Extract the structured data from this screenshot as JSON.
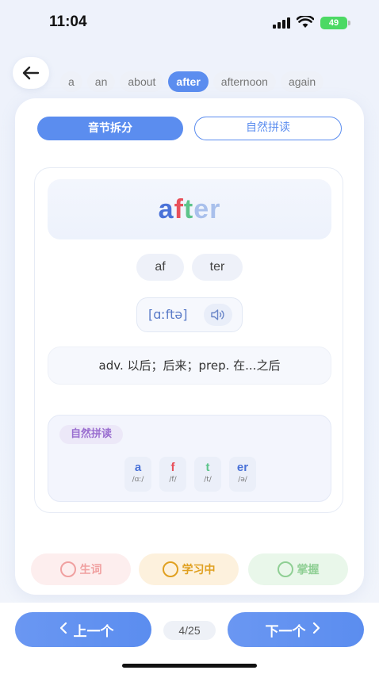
{
  "status_bar": {
    "time": "11:04",
    "battery": "49"
  },
  "word_list": [
    "a",
    "an",
    "about",
    "after",
    "afternoon",
    "again"
  ],
  "word_list_active": "after",
  "mode_tabs": {
    "split": "音节拆分",
    "phonics": "自然拼读"
  },
  "word": {
    "letters": [
      "a",
      "f",
      "t",
      "er"
    ],
    "syllables": [
      "af",
      "ter"
    ],
    "phonetic": "[ɑːftə]",
    "meaning": "adv. 以后；后来；prep. 在...之后"
  },
  "phonics": {
    "label": "自然拼读",
    "units": [
      {
        "letter": "a",
        "ipa": "/ɑː/"
      },
      {
        "letter": "f",
        "ipa": "/f/"
      },
      {
        "letter": "t",
        "ipa": "/t/"
      },
      {
        "letter": "er",
        "ipa": "/ə/"
      }
    ]
  },
  "status_buttons": {
    "new": "生词",
    "learning": "学习中",
    "mastered": "掌握"
  },
  "navigation": {
    "prev": "上一个",
    "next": "下一个",
    "counter": "4/25"
  },
  "colors": {
    "accent": "#5b8def",
    "letter_a": "#4a72d8",
    "letter_f": "#e8505b",
    "letter_t": "#5cc48a",
    "letter_er": "#a9c0ec"
  }
}
